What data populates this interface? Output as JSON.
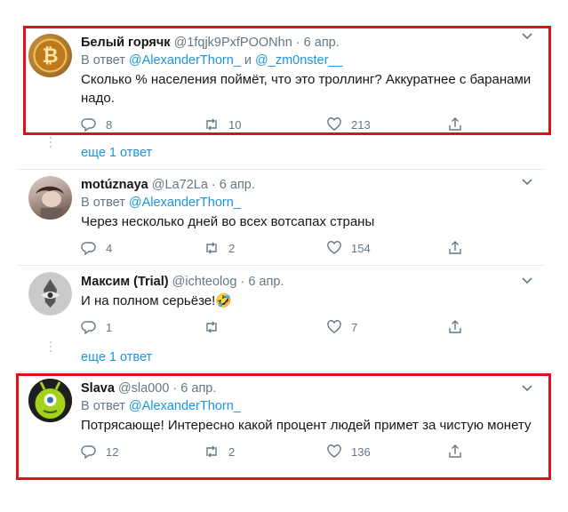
{
  "tweets": [
    {
      "name": "Белый горячк",
      "handle": "@1fqjk9PxfPOONhn",
      "dot": "·",
      "date": "6 апр.",
      "reply_prefix": "В ответ",
      "reply_mentions": [
        "@AlexanderThorn_",
        "@_zm0nster__"
      ],
      "reply_joiner": "и",
      "text": "Сколько % населения поймёт, что это троллинг? Аккуратнее с баранами надо.",
      "replies": "8",
      "retweets": "10",
      "likes": "213"
    },
    {
      "name": "motúznaya",
      "handle": "@La72La",
      "dot": "·",
      "date": "6 апр.",
      "reply_prefix": "В ответ",
      "reply_mentions": [
        "@AlexanderThorn_"
      ],
      "text": "Через несколько дней во всех вотсапах страны",
      "replies": "4",
      "retweets": "2",
      "likes": "154"
    },
    {
      "name": "Максим (Trial)",
      "handle": "@ichteolog",
      "dot": "·",
      "date": "6 апр.",
      "text": "И на полном серьёзе!🤣",
      "replies": "1",
      "retweets": "",
      "likes": "7"
    },
    {
      "name": "Slava",
      "handle": "@sla000",
      "dot": "·",
      "date": "6 апр.",
      "reply_prefix": "В ответ",
      "reply_mentions": [
        "@AlexanderThorn_"
      ],
      "text": "Потрясающе! Интересно какой процент людей примет за чистую монету",
      "replies": "12",
      "retweets": "2",
      "likes": "136"
    }
  ],
  "show_more_1": "еще 1 ответ",
  "show_more_2": "еще 1 ответ",
  "colors": {
    "accent": "#1b95e0",
    "secondary_text": "#657786",
    "highlight_box": "#e0101a"
  },
  "icons": [
    "reply-icon",
    "retweet-icon",
    "like-icon",
    "share-icon",
    "chevron-down-icon"
  ]
}
